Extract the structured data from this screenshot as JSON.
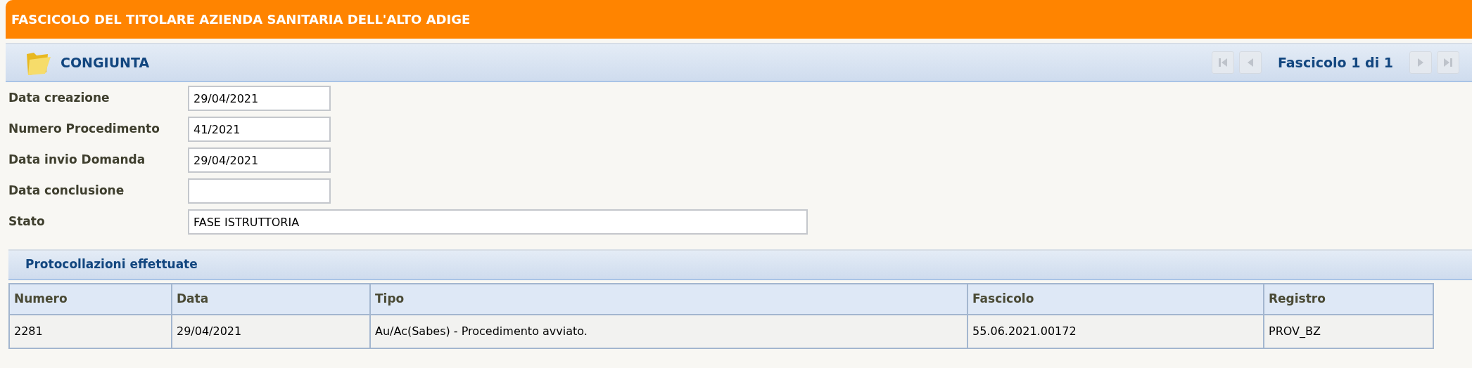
{
  "header": {
    "title": "FASCICOLO DEL TITOLARE AZIENDA SANITARIA DELL'ALTO ADIGE"
  },
  "toolbar": {
    "title": "CONGIUNTA",
    "pager": "Fascicolo 1 di 1",
    "nav_buttons": [
      {
        "kind": "first",
        "disabled": true
      },
      {
        "kind": "prev",
        "disabled": true
      },
      {
        "kind": "next",
        "disabled": true
      },
      {
        "kind": "last",
        "disabled": true
      }
    ]
  },
  "fields": [
    {
      "label": "Data creazione",
      "value": "29/04/2021",
      "kind": "short"
    },
    {
      "label": "Numero Procedimento",
      "value": "41/2021",
      "kind": "short"
    },
    {
      "label": "Data invio Domanda",
      "value": "29/04/2021",
      "kind": "short"
    },
    {
      "label": "Data conclusione",
      "kind": "short"
    },
    {
      "label": "Stato",
      "value": "FASE ISTRUTTORIA",
      "kind": "wide"
    }
  ],
  "section": {
    "title": "Protocollazioni effettuate"
  },
  "table": {
    "columns": [
      "Numero",
      "Data",
      "Tipo",
      "Fascicolo",
      "Registro"
    ],
    "rows": [
      [
        "2281",
        "29/04/2021",
        "Au/Ac(Sabes) - Procedimento avviato.",
        "55.06.2021.00172",
        "PROV_BZ"
      ]
    ]
  }
}
